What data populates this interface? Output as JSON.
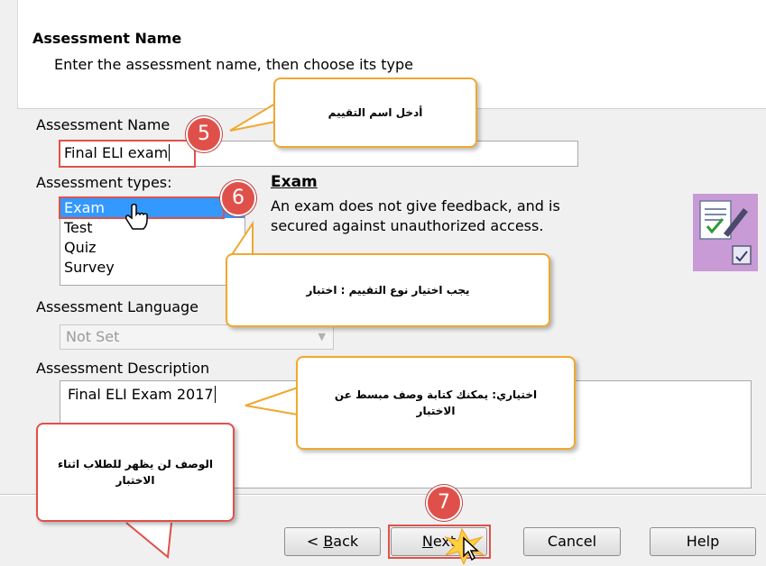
{
  "header": {
    "title": "Assessment Name",
    "subtitle": "Enter the assessment name,  then choose its type"
  },
  "form": {
    "name_label": "Assessment Name",
    "name_value": "Final ELI exam",
    "types_label": "Assessment types:",
    "types": [
      "Exam",
      "Test",
      "Quiz",
      "Survey"
    ],
    "selected_type": "Exam",
    "exam_heading": "Exam",
    "exam_description_line1": "An exam does not give feedback, and is",
    "exam_description_line2": "secured against unauthorized access.",
    "language_label": "Assessment Language",
    "language_value": "Not Set",
    "description_label": "Assessment Description",
    "description_value": "Final ELI Exam 2017"
  },
  "buttons": {
    "back_prefix": "< ",
    "back_mnemonic": "B",
    "back_rest": "ack",
    "next_mnemonic": "N",
    "next_rest": "ext",
    "cancel": "Cancel",
    "help": "Help"
  },
  "callouts": {
    "name_hint": "أدخل اسم التقييم",
    "type_hint": "يجب اختيار نوع التقييم : اختبار",
    "description_hint_line1": "اختياري: يمكنك كتابة وصف مبسط عن",
    "description_hint_line2": "الاختبار",
    "visibility_hint_line1": "الوصف لن يظهر للطلاب اثناء",
    "visibility_hint_line2": "الاختبار"
  },
  "steps": [
    "5",
    "6",
    "7"
  ],
  "colors": {
    "selection": "#3399ff",
    "callout_border": "#f0a830",
    "step_badge": "#e0504a"
  }
}
